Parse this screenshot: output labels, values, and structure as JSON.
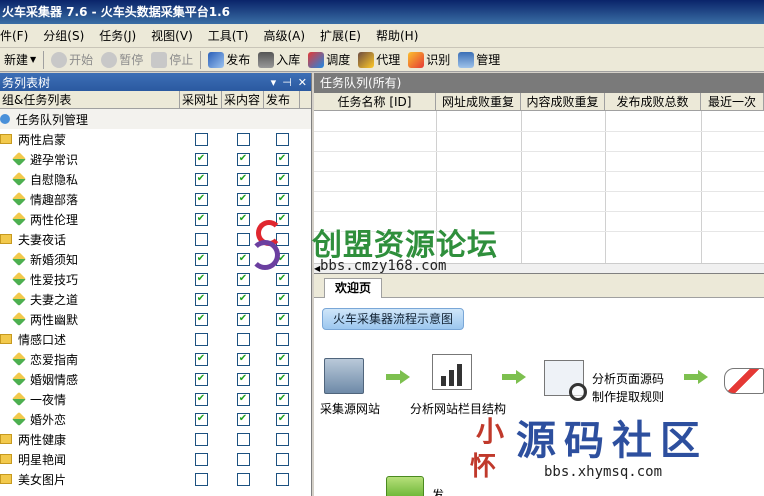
{
  "window": {
    "title": "火车采集器 7.6 - 火车头数据采集平台1.6"
  },
  "menu": [
    "件(F)",
    "分组(S)",
    "任务(J)",
    "视图(V)",
    "工具(T)",
    "高级(A)",
    "扩展(E)",
    "帮助(H)"
  ],
  "toolbar": {
    "new": "新建",
    "start": "开始",
    "pause": "暂停",
    "stop": "停止",
    "publish": "发布",
    "import": "入库",
    "debug": "调度",
    "proxy": "代理",
    "recognize": "识别",
    "manage": "管理"
  },
  "left_panel": {
    "title": "务列表树",
    "controls": [
      "▾",
      "⊣",
      "✕"
    ],
    "columns": [
      "组&任务列表",
      "采网址",
      "采内容",
      "发布"
    ],
    "root": "任务队列管理",
    "rows": [
      {
        "label": "两性启蒙",
        "type": "group",
        "c": [
          false,
          false,
          false
        ]
      },
      {
        "label": "避孕常识",
        "type": "task",
        "c": [
          true,
          true,
          true
        ]
      },
      {
        "label": "自慰隐私",
        "type": "task",
        "c": [
          true,
          true,
          true
        ]
      },
      {
        "label": "情趣部落",
        "type": "task",
        "c": [
          true,
          true,
          true
        ]
      },
      {
        "label": "两性伦理",
        "type": "task",
        "c": [
          true,
          true,
          true
        ]
      },
      {
        "label": "夫妻夜话",
        "type": "group",
        "c": [
          false,
          false,
          false
        ]
      },
      {
        "label": "新婚须知",
        "type": "task",
        "c": [
          true,
          true,
          true
        ]
      },
      {
        "label": "性爱技巧",
        "type": "task",
        "c": [
          true,
          true,
          true
        ]
      },
      {
        "label": "夫妻之道",
        "type": "task",
        "c": [
          true,
          true,
          true
        ]
      },
      {
        "label": "两性幽默",
        "type": "task",
        "c": [
          true,
          true,
          true
        ]
      },
      {
        "label": "情感口述",
        "type": "group",
        "c": [
          false,
          false,
          false
        ]
      },
      {
        "label": "恋爱指南",
        "type": "task",
        "c": [
          true,
          true,
          true
        ]
      },
      {
        "label": "婚姻情感",
        "type": "task",
        "c": [
          true,
          true,
          true
        ]
      },
      {
        "label": "一夜情",
        "type": "task",
        "c": [
          true,
          true,
          true
        ]
      },
      {
        "label": "婚外恋",
        "type": "task",
        "c": [
          true,
          true,
          true
        ]
      },
      {
        "label": "两性健康",
        "type": "group",
        "c": [
          false,
          false,
          false
        ]
      },
      {
        "label": "明星艳闻",
        "type": "group",
        "c": [
          false,
          false,
          false
        ]
      },
      {
        "label": "美女图片",
        "type": "group",
        "c": [
          false,
          false,
          false
        ]
      }
    ]
  },
  "queue": {
    "title": "任务队列(所有)",
    "columns": [
      "任务名称 [ID]",
      "网址成败重复",
      "内容成败重复",
      "发布成败总数",
      "最近一次"
    ]
  },
  "welcome": {
    "tab": "欢迎页",
    "flow_title": "火车采集器流程示意图",
    "step1": "采集源网站",
    "step2": "分析网站栏目结构",
    "step3_line1": "分析页面源码",
    "step3_line2": "制作提取规则",
    "bottom_label": "发"
  },
  "watermarks": {
    "wm1_title": "创盟资源论坛",
    "wm1_url": "bbs.cmzy168.com",
    "wm2_title": "源码社区",
    "wm2_url": "bbs.xhymsq.com",
    "wm2_seal1": "小",
    "wm2_seal2": "怀"
  },
  "colors": {
    "check": "#21a121",
    "titlebar": "#0a246a",
    "accent_green": "#7dc04f"
  }
}
